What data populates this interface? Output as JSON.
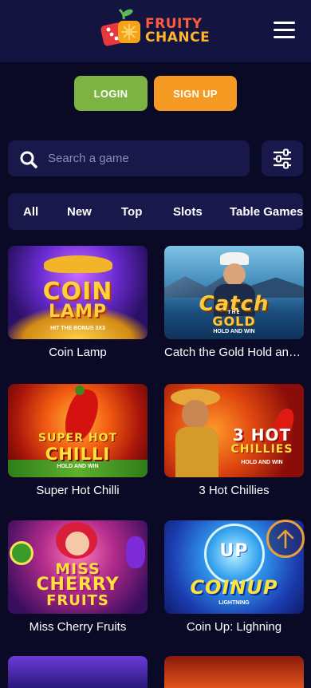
{
  "brand": {
    "line1": "FRUITY",
    "line2": "CHANCE"
  },
  "auth": {
    "login_label": "LOGIN",
    "signup_label": "SIGN UP"
  },
  "search": {
    "placeholder": "Search a game"
  },
  "tabs": [
    "All",
    "New",
    "Top",
    "Slots",
    "Table Games"
  ],
  "games": [
    {
      "title": "Coin Lamp",
      "art_main": "COIN",
      "art_main2": "LAMP",
      "art_sub": "HIT THE BONUS 3X3"
    },
    {
      "title": "Catch the Gold Hold and Win",
      "art_main": "Catch",
      "art_main2": "GOLD",
      "art_sub": "HOLD AND WIN",
      "art_small": "THE"
    },
    {
      "title": "Super Hot Chilli",
      "art_main": "SUPER HOT",
      "art_main2": "CHILLI",
      "art_sub": "HOLD AND WIN"
    },
    {
      "title": "3 Hot Chillies",
      "art_main": "3 HOT",
      "art_main2": "CHILLIES",
      "art_sub": "HOLD AND WIN"
    },
    {
      "title": "Miss Cherry Fruits",
      "art_main": "MISS",
      "art_main2": "CHERRY",
      "art_main3": "FRUITS"
    },
    {
      "title": "Coin Up: Lighning",
      "art_main": "UP",
      "art_main2": "COINUP",
      "art_sub": "LIGHTNING"
    }
  ],
  "colors": {
    "background": "#0b0a26",
    "header": "#141440",
    "panel": "#19184a",
    "login": "#7cb342",
    "signup": "#f59a23",
    "scroll_top_ring": "#e9a03a"
  },
  "icons": [
    "fruity-chance-logo",
    "menu-icon",
    "search-icon",
    "filter-sliders-icon",
    "arrow-up-icon"
  ]
}
